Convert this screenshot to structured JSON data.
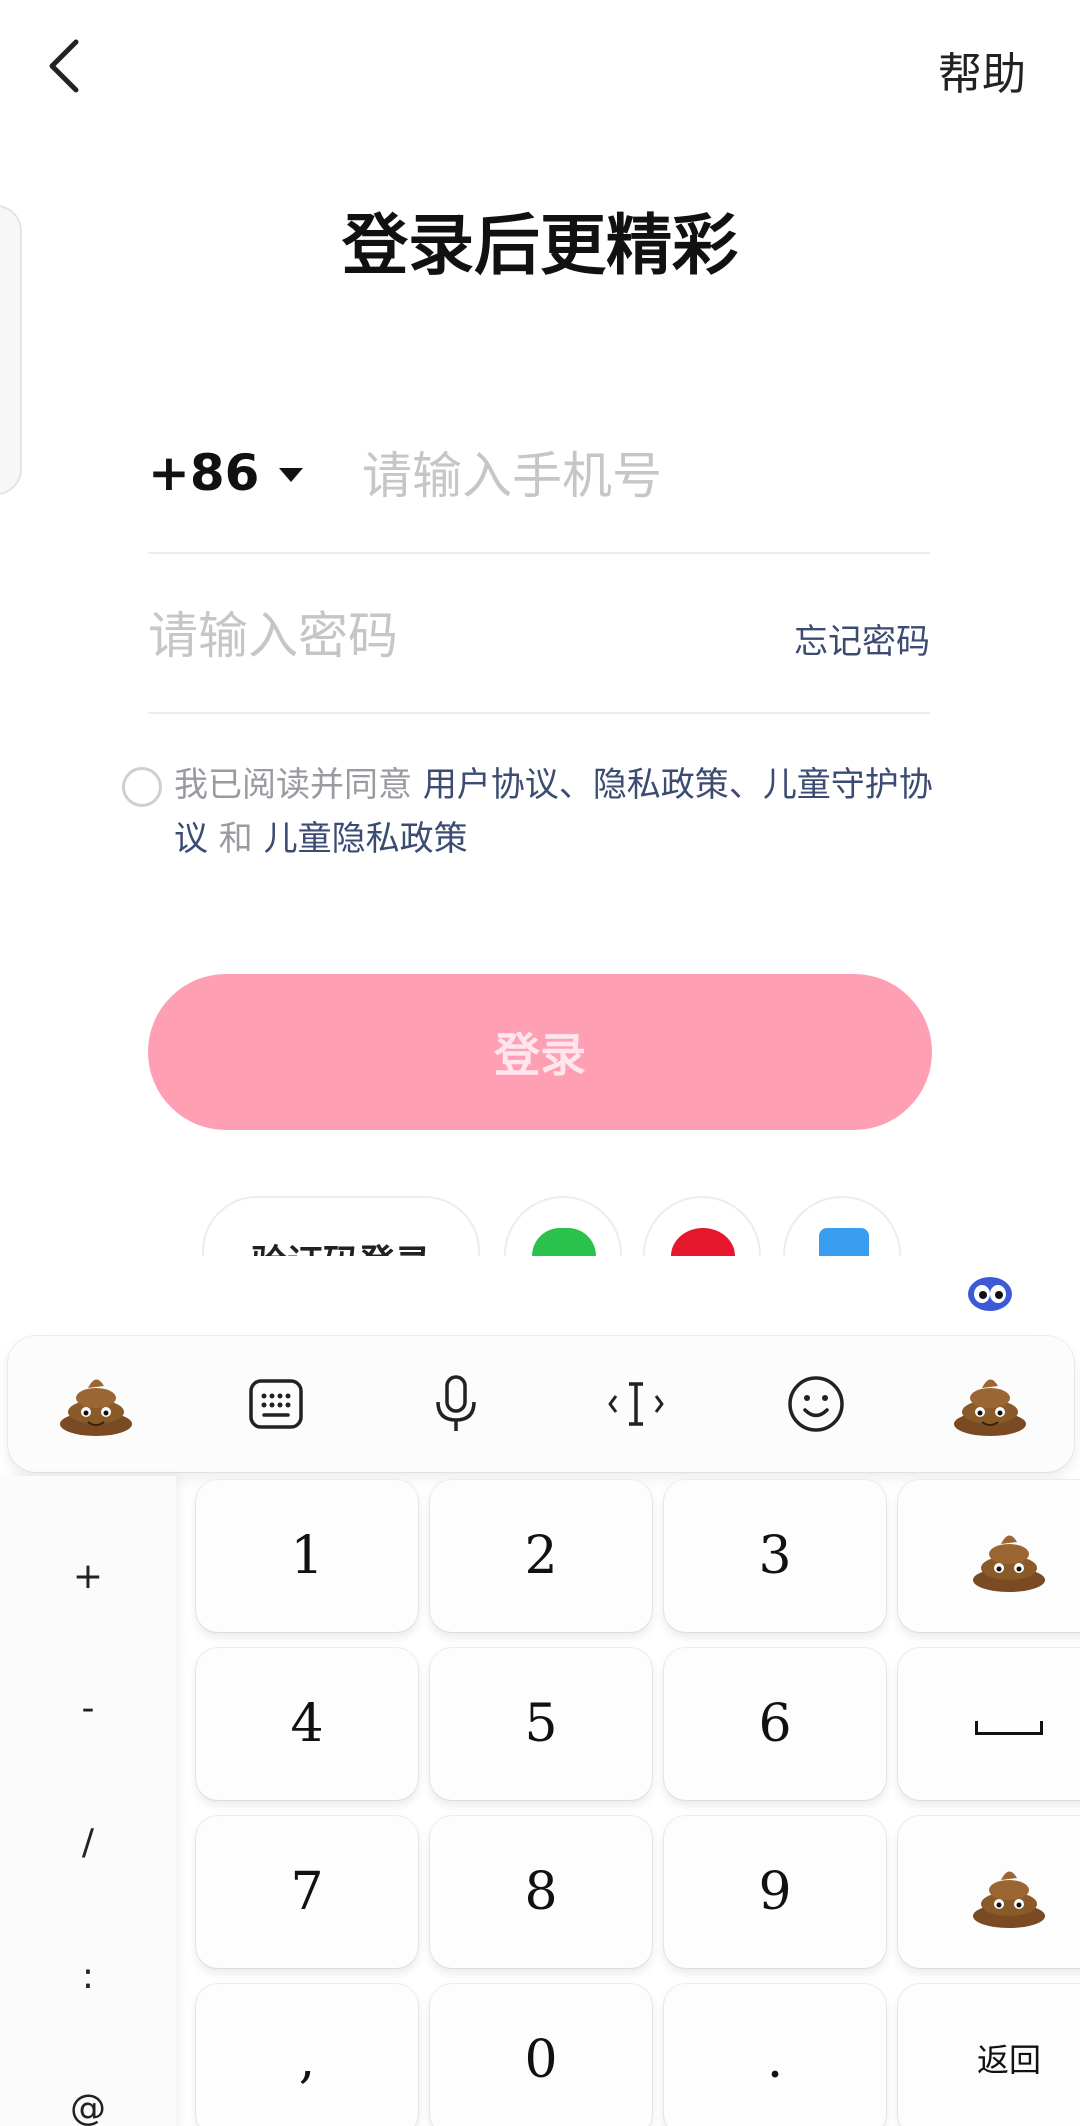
{
  "header": {
    "help_label": "帮助"
  },
  "title": "登录后更精彩",
  "phone": {
    "country_code": "+86",
    "placeholder": "请输入手机号"
  },
  "password": {
    "placeholder": "请输入密码",
    "forgot_label": "忘记密码"
  },
  "agreement": {
    "prefix": "我已阅读并同意 ",
    "user_agreement": "用户协议",
    "sep1": "、",
    "privacy_policy": "隐私政策",
    "sep2": "、",
    "child_protection": "儿童守护协议",
    "and": " 和 ",
    "child_privacy": "儿童隐私政策"
  },
  "login_label": "登录",
  "alt_login": {
    "sms_label": "验证码登录"
  },
  "keyboard": {
    "left_symbols": [
      "+",
      "-",
      "/",
      ":",
      "@"
    ],
    "keys": [
      "1",
      "2",
      "3",
      "4",
      "5",
      "6",
      "7",
      "8",
      "9",
      ",",
      "0",
      ".",
      "返回"
    ]
  },
  "colors": {
    "login_button": "#fe9fb4",
    "link": "#3b4b72",
    "placeholder": "#c6c6c9"
  }
}
